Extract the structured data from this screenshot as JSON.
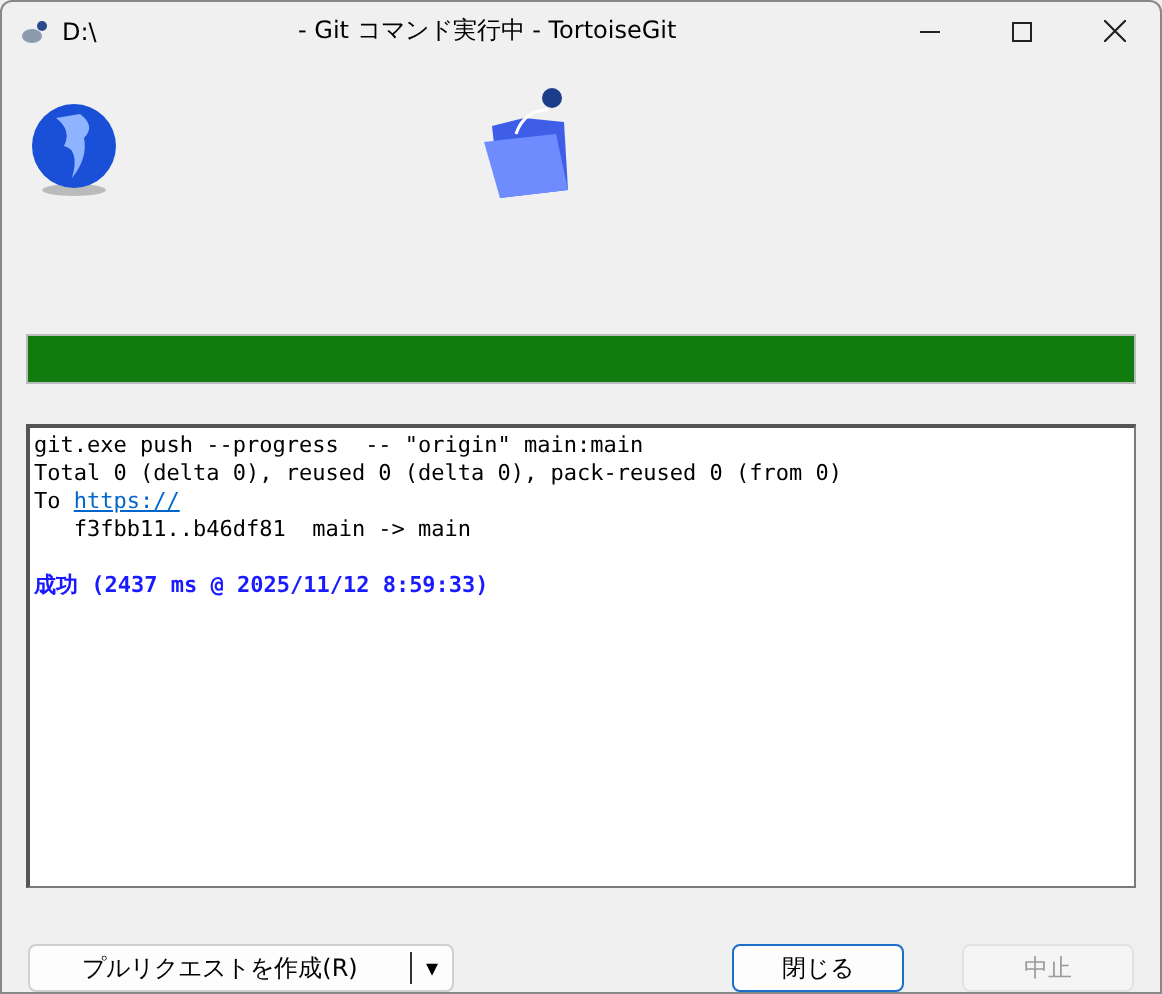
{
  "window": {
    "path": "D:\\",
    "title": "- Git コマンド実行中 - TortoiseGit"
  },
  "progress": {
    "level": 1.0
  },
  "log": [
    {
      "kind": "text",
      "text": "git.exe push --progress  -- \"origin\" main:main"
    },
    {
      "kind": "text",
      "text": "Total 0 (delta 0), reused 0 (delta 0), pack-reused 0 (from 0)"
    },
    {
      "kind": "link",
      "text": "To ",
      "link": "https://"
    },
    {
      "kind": "text",
      "text": "   f3fbb11..b46df81  main -> main"
    },
    {
      "kind": "blank"
    },
    {
      "kind": "success",
      "text": "成功 (2437 ms @ 2025/11/12 8:59:33)"
    }
  ],
  "buttons": {
    "split": {
      "label": "プルリクエストを作成(R)",
      "arrow": "▾"
    },
    "close": {
      "label": "閉じる",
      "disabled": false
    },
    "abort": {
      "label": "中止",
      "disabled": true
    }
  }
}
